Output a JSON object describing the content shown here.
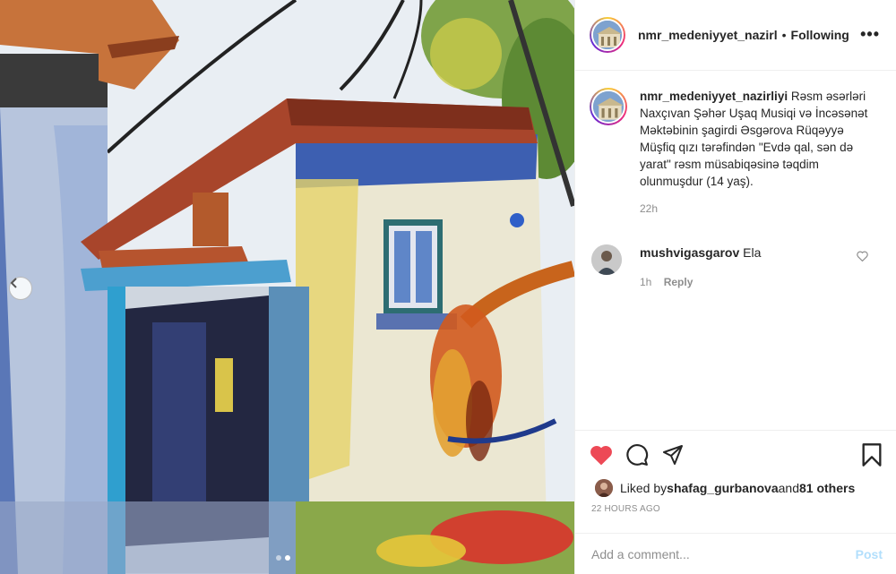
{
  "post": {
    "username": "nmr_medeniyyet_nazirl",
    "separator": "•",
    "follow_state": "Following",
    "more_icon": "more-horizontal-icon",
    "image_alt": "Watercolor painting of an old house"
  },
  "caption": {
    "username": "nmr_medeniyyet_nazirliyi",
    "text": " Rəsm əsərləri Naxçıvan Şəhər Uşaq Musiqi və İncəsənət Məktəbinin şagirdi Əsgərova Rüqəyyə Müşfiq qızı tərəfindən \"Evdə qal, sən də yarat\" rəsm müsabiqəsinə təqdim olunmuşdur (14 yaş).",
    "age": "22h"
  },
  "comments": [
    {
      "username": "mushvigasgarov",
      "text": " Ela",
      "age": "1h",
      "reply_label": "Reply"
    }
  ],
  "likes": {
    "prefix": "Liked by ",
    "user": "shafag_gurbanova",
    "middle": " and ",
    "others": "81 others"
  },
  "timestamp": "22 HOURS AGO",
  "add_comment": {
    "placeholder": "Add a comment...",
    "post_label": "Post"
  },
  "carousel": {
    "total": 2,
    "active_index": 1
  },
  "colors": {
    "like_red": "#ed4956",
    "post_disabled": "#b2dffc",
    "muted": "#8e8e8e"
  }
}
